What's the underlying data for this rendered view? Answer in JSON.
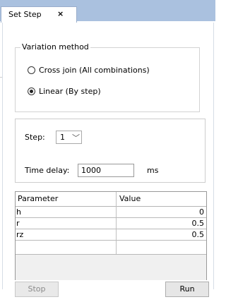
{
  "tab": {
    "title": "Set Step",
    "close_glyph": "×"
  },
  "variation": {
    "legend": "Variation method",
    "options": [
      {
        "label": "Cross join (All combinations)",
        "checked": false
      },
      {
        "label": "Linear (By step)",
        "checked": true
      }
    ]
  },
  "step": {
    "label": "Step:",
    "value": "1",
    "chevron_icon": "chevron-down-icon",
    "delay_label": "Time delay:",
    "delay_value": "1000",
    "delay_unit": "ms"
  },
  "table": {
    "headers": [
      "Parameter",
      "Value"
    ],
    "rows": [
      {
        "name": "h",
        "value": "0"
      },
      {
        "name": "r",
        "value": "0.5"
      },
      {
        "name": "rz",
        "value": "0.5"
      }
    ]
  },
  "buttons": {
    "stop": "Stop",
    "run": "Run"
  },
  "colors": {
    "tabstrip": "#aac1df",
    "disabled_text": "#8a8a8a"
  }
}
